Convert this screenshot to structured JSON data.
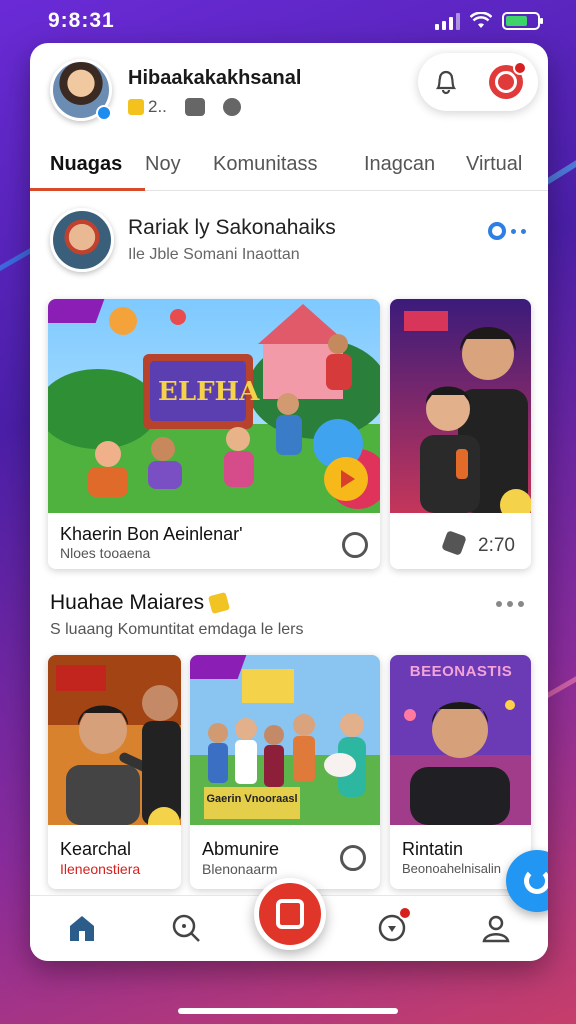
{
  "status_bar": {
    "time": "9:8:31"
  },
  "profile": {
    "username": "Hibaakakakhsanal",
    "coins": "2..",
    "avatar_alt": "user avatar"
  },
  "tabs": [
    {
      "label": "Nuagas",
      "active": true
    },
    {
      "label": "Noy",
      "active": false
    },
    {
      "label": "Komunitass",
      "active": false
    },
    {
      "label": "Inagcan",
      "active": false
    },
    {
      "label": "Virtual",
      "active": false
    }
  ],
  "featured": {
    "title": "Rariak ly Sakonahaiks",
    "subtitle": "Ile Jble Somani Inaottan",
    "videos": [
      {
        "thumb_text": "ELFHA",
        "title": "Khaerin Bon Aeinlenar'",
        "subtitle": "Nloes tooaenа"
      },
      {
        "thumb_text": "",
        "duration": "2:70"
      }
    ]
  },
  "section2": {
    "title": "Huahae Maiares",
    "subtitle": "S luaang Komuntitat emdaga le lers",
    "cards": [
      {
        "title": "Kearchal",
        "subtitle": "Ileneonstiera",
        "subtitle_color": "#d62020"
      },
      {
        "title": "Abmunire",
        "subtitle": "Blenonaarm",
        "banner": "Gaerin Vnooraasl"
      },
      {
        "title": "Rintatin",
        "subtitle": "Beonoahelnisalin",
        "banner": "BEEONASTIS"
      }
    ]
  },
  "colors": {
    "accent": "#d94a2a",
    "record": "#e0362a",
    "fab": "#2196f3",
    "tag": "#8b1fb5"
  },
  "nav": {
    "items": [
      "home-icon",
      "search-icon",
      "record-icon",
      "chat-icon",
      "profile-icon"
    ]
  }
}
